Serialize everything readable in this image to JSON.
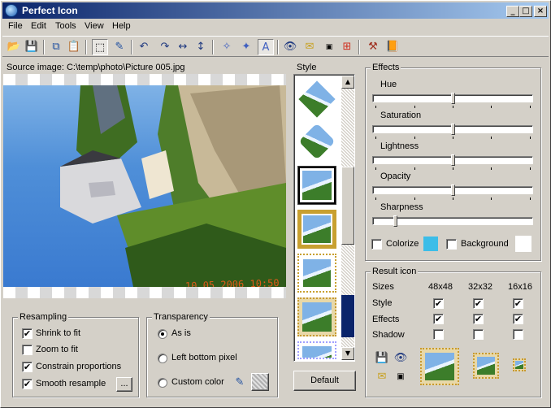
{
  "window": {
    "title": "Perfect Icon",
    "min": "_",
    "max": "□",
    "close": "×"
  },
  "menu": [
    "File",
    "Edit",
    "Tools",
    "View",
    "Help"
  ],
  "source": {
    "label": "Source image: C:\\temp\\photo\\Picture 005.jpg",
    "stamp": "10 05 2006 10:50"
  },
  "style": {
    "label": "Style",
    "default_button": "Default"
  },
  "resampling": {
    "label": "Resampling",
    "items": [
      {
        "label": "Shrink to fit",
        "checked": true
      },
      {
        "label": "Zoom to fit",
        "checked": false
      },
      {
        "label": "Constrain proportions",
        "checked": true
      },
      {
        "label": "Smooth resample",
        "checked": true
      }
    ],
    "more_button": "..."
  },
  "transparency": {
    "label": "Transparency",
    "options": [
      {
        "label": "As is",
        "selected": true
      },
      {
        "label": "Left bottom pixel",
        "selected": false
      },
      {
        "label": "Custom color",
        "selected": false
      }
    ]
  },
  "effects": {
    "label": "Effects",
    "sliders": [
      {
        "label": "Hue",
        "value": 0.5
      },
      {
        "label": "Saturation",
        "value": 0.5
      },
      {
        "label": "Lightness",
        "value": 0.5
      },
      {
        "label": "Opacity",
        "value": 0.5
      },
      {
        "label": "Sharpness",
        "value": 0.13
      }
    ],
    "colorize": "Colorize",
    "background": "Background",
    "colorize_color": "#3cbde8",
    "background_color": "#ffffff"
  },
  "result": {
    "label": "Result icon",
    "headers": [
      "Sizes",
      "48x48",
      "32x32",
      "16x16"
    ],
    "rows": [
      {
        "label": "Style",
        "checks": [
          true,
          true,
          true
        ]
      },
      {
        "label": "Effects",
        "checks": [
          true,
          true,
          true
        ]
      },
      {
        "label": "Shadow",
        "checks": [
          false,
          false,
          false
        ]
      }
    ]
  }
}
